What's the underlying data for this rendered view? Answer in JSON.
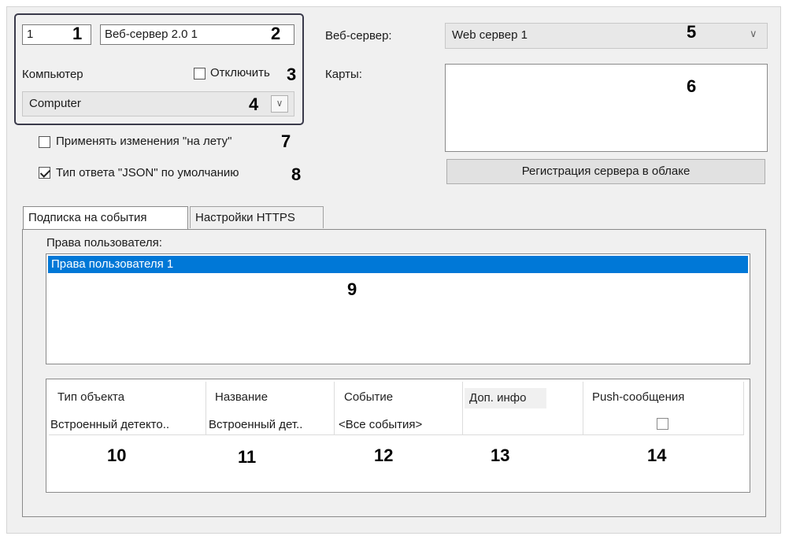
{
  "id_field": "1",
  "name_field": "Веб-сервер 2.0 1",
  "computer_label": "Компьютер",
  "disable_label": "Отключить",
  "computer_select": "Computer",
  "apply_on_fly_label": "Применять изменения \"на лету\"",
  "json_default_label": "Тип ответа \"JSON\" по умолчанию",
  "webserver_label": "Веб-сервер:",
  "webserver_select": "Web сервер 1",
  "maps_label": "Карты:",
  "register_cloud_button": "Регистрация сервера в облаке",
  "tabs": [
    "Подписка на события",
    "Настройки HTTPS"
  ],
  "user_rights_label": "Права пользователя:",
  "user_rights_items": [
    "Права пользователя 1"
  ],
  "table": {
    "headers": [
      "Тип объекта",
      "Название",
      "Событие",
      "Доп. инфо",
      "Push-сообщения"
    ],
    "rows": [
      [
        "Встроенный детекто..",
        "Встроенный дет..",
        "<Все события>",
        "",
        ""
      ]
    ]
  },
  "callouts": [
    "1",
    "2",
    "3",
    "4",
    "5",
    "6",
    "7",
    "8",
    "9",
    "10",
    "11",
    "12",
    "13",
    "14"
  ],
  "colors": {
    "selection": "#0078d7",
    "frame": "#3a3a4a",
    "panel": "#f0f0f0"
  }
}
